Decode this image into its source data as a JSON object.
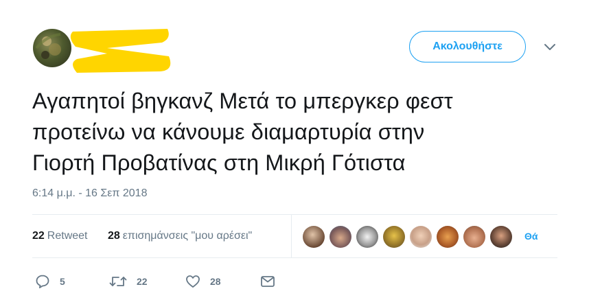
{
  "follow_button": {
    "label": "Ακολουθήστε"
  },
  "tweet": {
    "text": "Αγαπητοί βηγκανζ Μετά το μπεργκερ φεστ\nπροτείνω να κάνουμε διαμαρτυρία στην\nΓιορτή Προβατίνας στη Μικρή Γότιστα",
    "timestamp": "6:14 μ.μ. - 16 Σεπ 2018"
  },
  "stats": {
    "retweets_count": "22",
    "retweets_label": "Retweet",
    "likes_count": "28",
    "likes_label": "επισημάνσεις \"μου αρέσει\"",
    "more_label": "Θά"
  },
  "actions": {
    "replies": "5",
    "retweets": "22",
    "likes": "28"
  },
  "colors": {
    "accent": "#1da1f2",
    "muted": "#657786",
    "text": "#14171a",
    "redaction": "#ffd500"
  },
  "icons": [
    "chevron-down-icon",
    "reply-icon",
    "retweet-icon",
    "heart-icon",
    "message-icon"
  ]
}
